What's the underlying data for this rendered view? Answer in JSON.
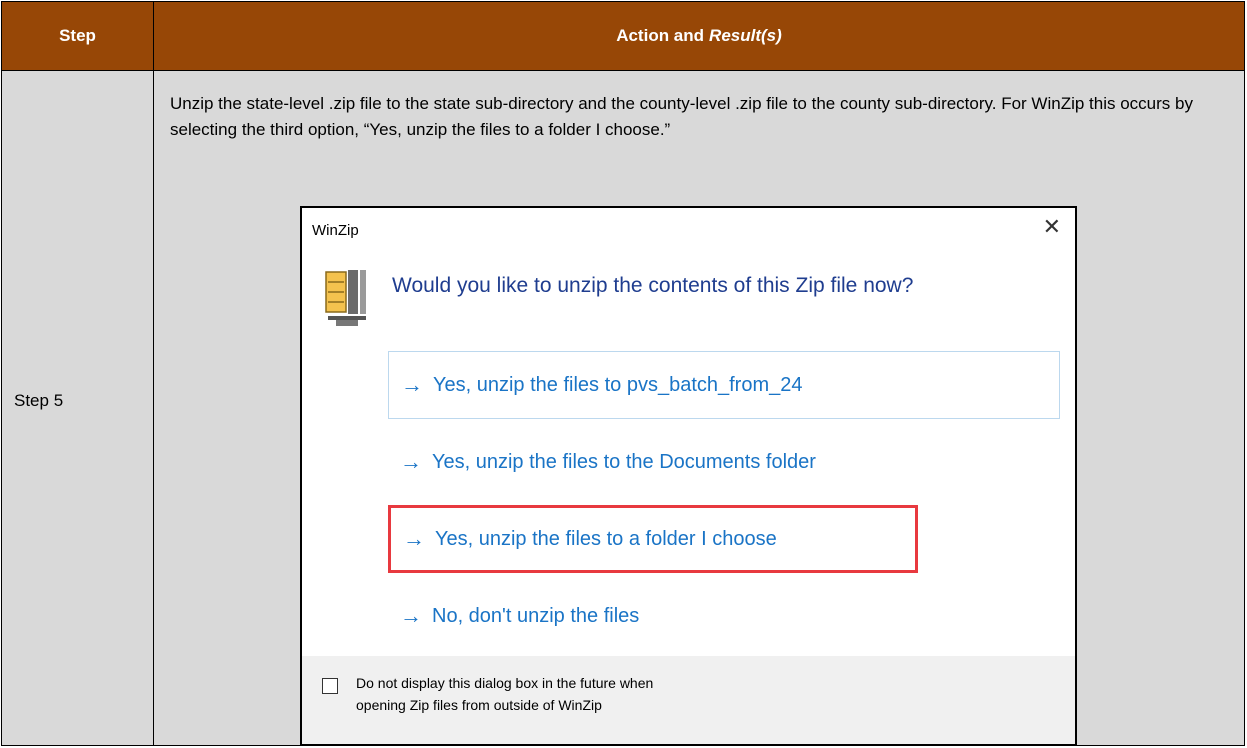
{
  "table": {
    "header_step": "Step",
    "header_action": "Action and",
    "header_action_italic": "Result(s)",
    "step_label": "Step 5",
    "instruction": "Unzip the state-level .zip file to the state sub-directory and the county-level .zip file to the county sub-directory. For WinZip this occurs by selecting the third option, “Yes, unzip the files to a folder I choose.”"
  },
  "dialog": {
    "title": "WinZip",
    "close_glyph": "✕",
    "question": "Would you like to unzip the contents of this Zip file now?",
    "arrow_glyph": "→",
    "options": [
      "Yes, unzip the files to pvs_batch_from_24",
      "Yes, unzip the files to the Documents folder",
      "Yes, unzip the files to a folder I choose",
      "No, don't unzip the files"
    ],
    "checkbox_label_line1": "Do not display this dialog box in the future when",
    "checkbox_label_line2": "opening Zip files from outside of WinZip",
    "checkbox_checked": false
  },
  "colors": {
    "header_bg": "#974706",
    "body_bg": "#d9d9d9",
    "option_text": "#1a74c6",
    "question_text": "#1f3d8f",
    "highlight_border": "#e8393f"
  }
}
